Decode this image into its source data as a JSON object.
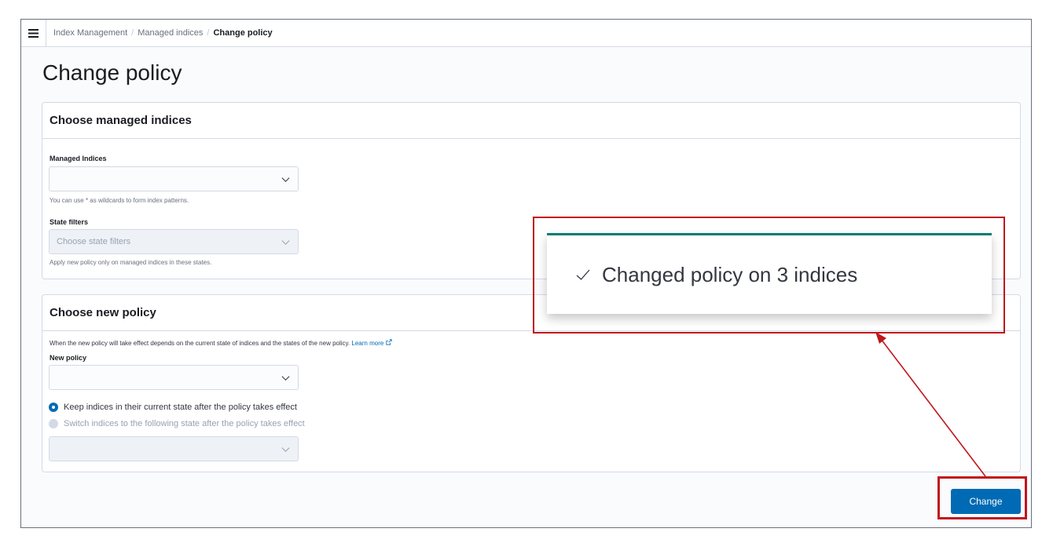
{
  "breadcrumbs": {
    "items": [
      "Index Management",
      "Managed indices"
    ],
    "current": "Change policy",
    "separator": "/"
  },
  "page": {
    "title": "Change policy"
  },
  "choose_managed": {
    "title": "Choose managed indices",
    "managed_label": "Managed Indices",
    "managed_value": "",
    "managed_help": "You can use * as wildcards to form index patterns.",
    "state_label": "State filters",
    "state_placeholder": "Choose state filters",
    "state_help": "Apply new policy only on managed indices in these states."
  },
  "choose_new": {
    "title": "Choose new policy",
    "description": "When the new policy will take effect depends on the current state of indices and the states of the new policy.",
    "learn_more": "Learn more",
    "new_policy_label": "New policy",
    "new_policy_value": "",
    "radio_keep": "Keep indices in their current state after the policy takes effect",
    "radio_switch": "Switch indices to the following state after the policy takes effect",
    "radio_keep_selected": true
  },
  "actions": {
    "change_label": "Change"
  },
  "toast": {
    "message": "Changed policy on 3 indices",
    "icon": "check-icon"
  },
  "colors": {
    "primary": "#006bb4",
    "toast_accent": "#017d73",
    "annotation": "#c0161c"
  }
}
